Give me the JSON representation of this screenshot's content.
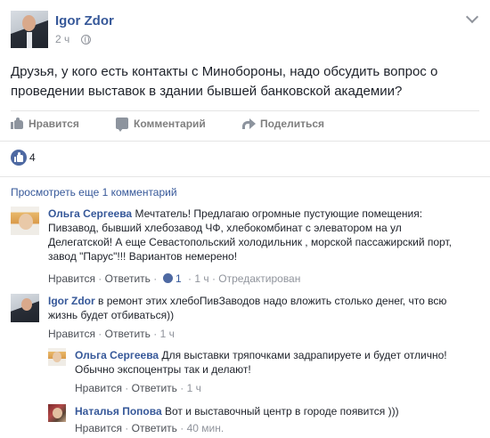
{
  "post": {
    "author": "Igor Zdor",
    "time": "2 ч",
    "text": "Друзья, у кого есть контакты с Минобороны, надо обсудить вопрос о проведении выставок в здании бывшей банковской академии?",
    "actions": {
      "like": "Нравится",
      "comment": "Комментарий",
      "share": "Поделиться"
    },
    "reaction_count": "4",
    "more_comments": "Просмотреть еще 1 комментарий"
  },
  "comments": [
    {
      "author": "Ольга Сергеева",
      "text": "Мечтатель! Предлагаю огромные пустующие помещения: Пивзавод, бывший хлебозавод ЧФ, хлебокомбинат с элеватором на ул Делегатской! А еще Севастопольский холодильник , морской пассажирский порт, завод \"Парус\"!!! Вариантов немерено!",
      "like": "Нравится",
      "reply": "Ответить",
      "likes": "1",
      "time": "1 ч",
      "edited": "Отредактирован"
    },
    {
      "author": "Igor Zdor",
      "text": "в ремонт этих хлебоПивЗаводов надо вложить столько денег, что всю жизнь будет отбиваться))",
      "like": "Нравится",
      "reply": "Ответить",
      "time": "1 ч"
    }
  ],
  "replies": [
    {
      "author": "Ольга Сергеева",
      "text": "Для выставки тряпочками задрапируете и будет отлично! Обычно экспоцентры так и делают!",
      "like": "Нравится",
      "reply": "Ответить",
      "time": "1 ч"
    },
    {
      "author": "Наталья Попова",
      "text": "Вот и выставочный центр в городе появится )))",
      "like": "Нравится",
      "reply": "Ответить",
      "time": "40 мин."
    }
  ],
  "sep": "·",
  "colors": {
    "link": "#365899",
    "text": "#1d2129",
    "meta": "#90949c",
    "like_blue": "#4e69a2"
  },
  "icons": [
    "globe-icon",
    "chevron-down-icon",
    "thumbs-up-icon",
    "comment-icon",
    "share-icon",
    "like-reaction-icon"
  ]
}
